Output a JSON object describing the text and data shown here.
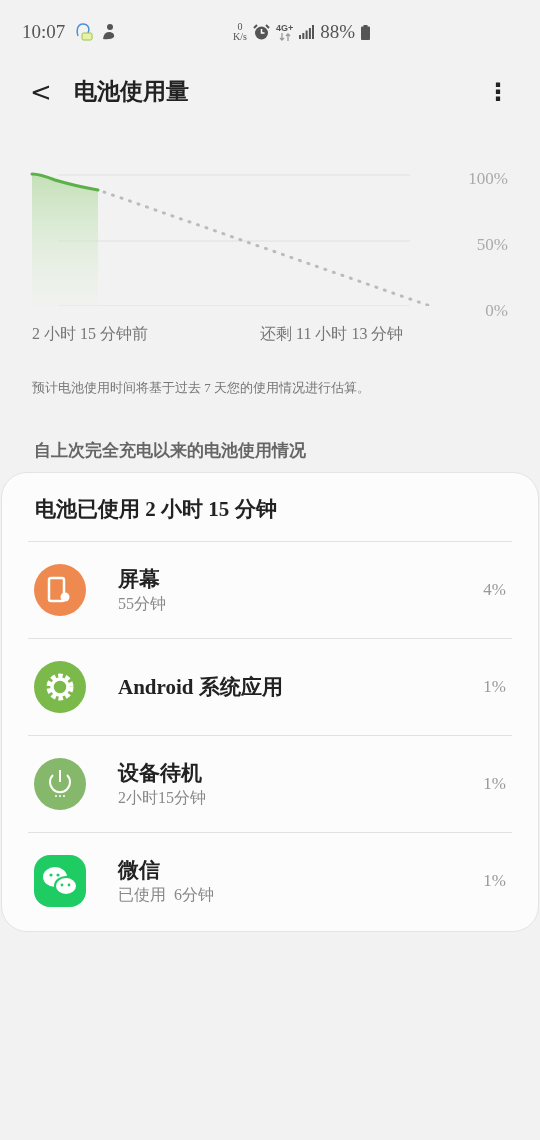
{
  "status_bar": {
    "time": "10:07",
    "net_speed_value": "0",
    "net_speed_unit": "K/s",
    "network": "4G+",
    "battery": "88%"
  },
  "header": {
    "back": "<",
    "title": "电池使用量",
    "menu": "⋮"
  },
  "chart": {
    "y_labels": [
      "100%",
      "50%",
      "0%"
    ],
    "start_label": "2 小时 15 分钟前",
    "end_label": "还剩 11 小时 13 分钟"
  },
  "note": "预计电池使用时间将基于过去 7 天您的使用情况进行估算。",
  "section_title": "自上次完全充电以来的电池使用情况",
  "card": {
    "title": "电池已使用 2 小时 15 分钟",
    "items": [
      {
        "name": "屏幕",
        "detail": "55分钟",
        "percent": "4%"
      },
      {
        "name": "Android 系统应用",
        "percent": "1%"
      },
      {
        "name": "设备待机",
        "detail": "2小时15分钟",
        "percent": "1%"
      },
      {
        "name": "微信",
        "detail": "已使用  6分钟",
        "percent": "1%"
      }
    ]
  }
}
